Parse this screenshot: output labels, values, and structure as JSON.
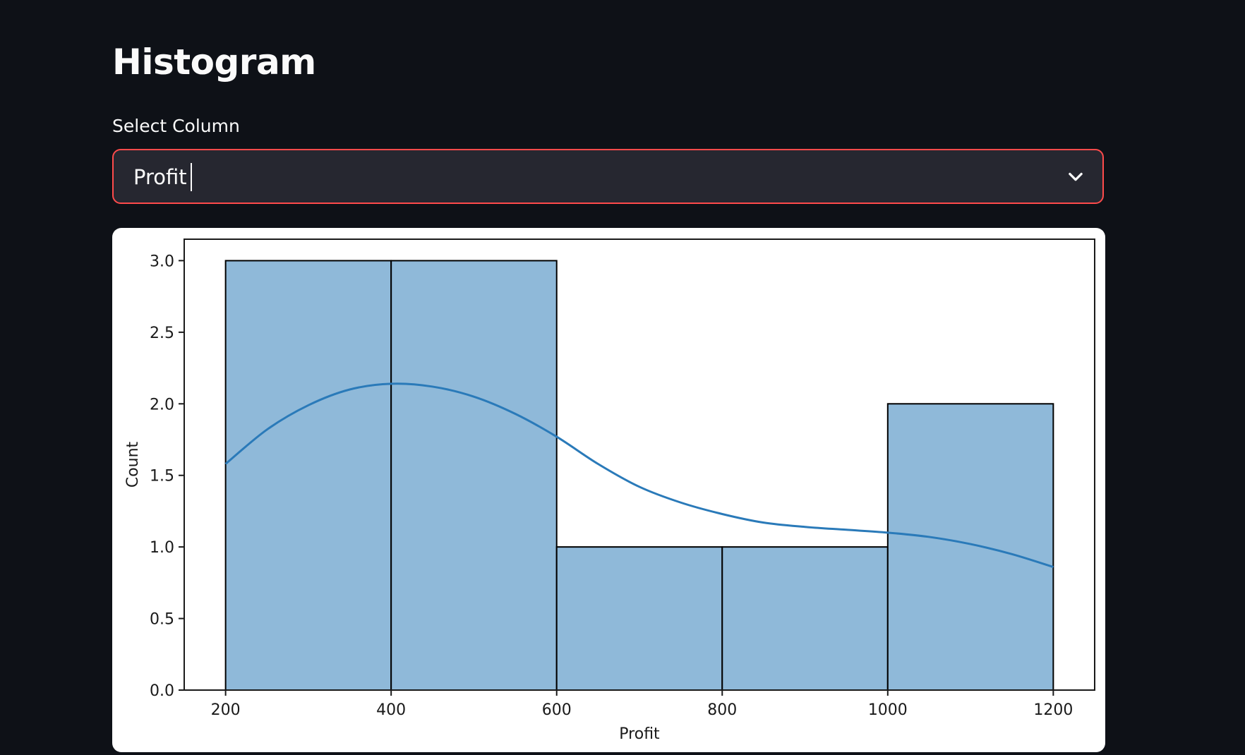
{
  "page": {
    "title": "Histogram"
  },
  "select": {
    "label": "Select Column",
    "value": "Profit",
    "icon": "chevron-down-icon"
  },
  "colors": {
    "background": "#0e1117",
    "select_border": "#ff4b4b",
    "bar_fill": "#8fb9d9",
    "kde_line": "#2a7ab9"
  },
  "chart_data": {
    "type": "bar",
    "subtype": "histogram-with-kde",
    "title": "",
    "xlabel": "Profit",
    "ylabel": "Count",
    "bins": [
      {
        "x0": 200,
        "x1": 400,
        "count": 3
      },
      {
        "x0": 400,
        "x1": 600,
        "count": 3
      },
      {
        "x0": 600,
        "x1": 800,
        "count": 1
      },
      {
        "x0": 800,
        "x1": 1000,
        "count": 1
      },
      {
        "x0": 1000,
        "x1": 1200,
        "count": 2
      }
    ],
    "kde": {
      "x": [
        200,
        250,
        300,
        350,
        400,
        450,
        500,
        550,
        600,
        650,
        700,
        750,
        800,
        850,
        900,
        950,
        1000,
        1050,
        1100,
        1150,
        1200
      ],
      "y": [
        1.58,
        1.82,
        1.99,
        2.1,
        2.14,
        2.12,
        2.05,
        1.93,
        1.77,
        1.58,
        1.42,
        1.31,
        1.23,
        1.17,
        1.14,
        1.12,
        1.1,
        1.07,
        1.02,
        0.95,
        0.86
      ]
    },
    "xlim": [
      150,
      1250
    ],
    "ylim": [
      0,
      3.15
    ],
    "xticks": [
      200,
      400,
      600,
      800,
      1000,
      1200
    ],
    "yticks": [
      0.0,
      0.5,
      1.0,
      1.5,
      2.0,
      2.5,
      3.0
    ],
    "xtick_labels": [
      "200",
      "400",
      "600",
      "800",
      "1000",
      "1200"
    ],
    "ytick_labels": [
      "0.0",
      "0.5",
      "1.0",
      "1.5",
      "2.0",
      "2.5",
      "3.0"
    ],
    "grid": false,
    "legend": "none"
  }
}
